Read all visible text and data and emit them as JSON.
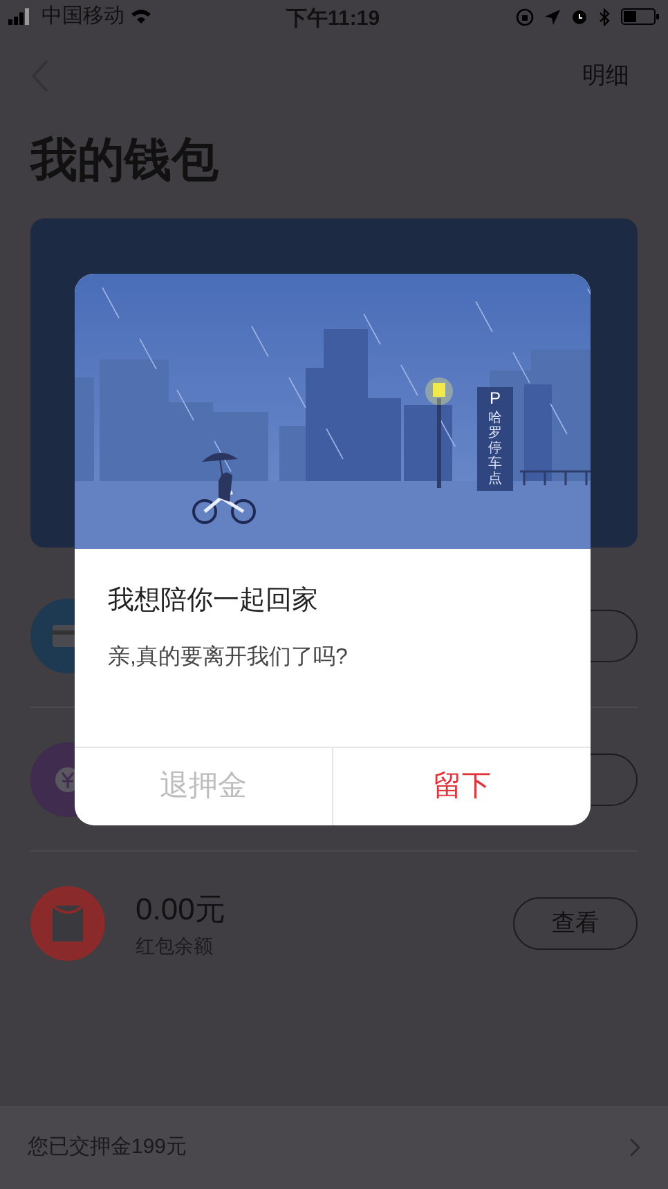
{
  "status_bar": {
    "carrier": "中国移动",
    "time": "下午11:19"
  },
  "nav": {
    "action": "明细"
  },
  "title": "我的钱包",
  "rows": [
    {
      "kind": "card",
      "color": "#1e3a52"
    },
    {
      "kind": "coin",
      "color": "#3f2c4f"
    },
    {
      "kind": "packet",
      "color": "#8a2a2a",
      "amount": "0.00元",
      "label": "红包余额",
      "button": "查看"
    }
  ],
  "footer": {
    "text": "您已交押金199元"
  },
  "dialog": {
    "sign_letter": "P",
    "sign_text": "哈罗停车点",
    "title": "我想陪你一起回家",
    "message": "亲,真的要离开我们了吗?",
    "buttons": [
      {
        "label": "退押金",
        "kind": "secondary"
      },
      {
        "label": "留下",
        "kind": "primary"
      }
    ]
  }
}
